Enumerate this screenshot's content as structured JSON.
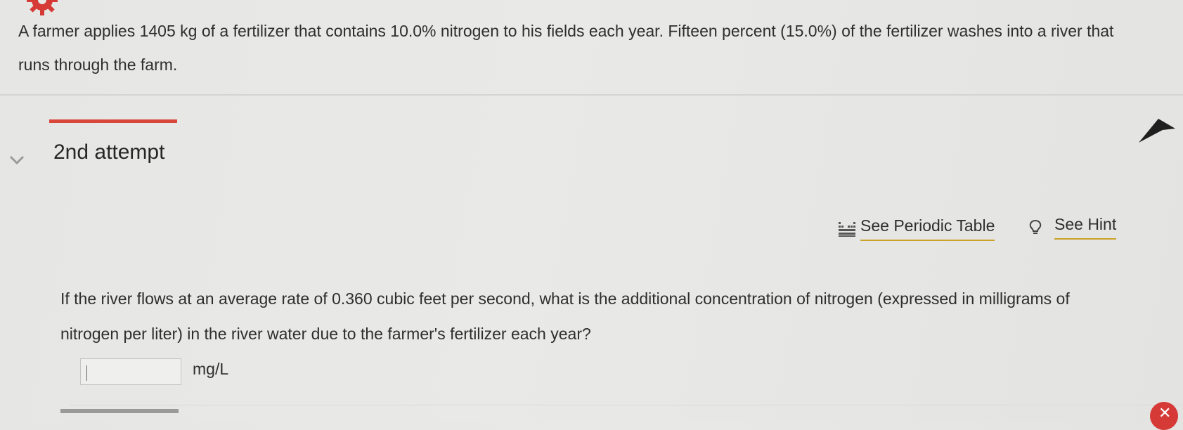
{
  "problem": {
    "text": "A farmer applies 1405 kg of a fertilizer that contains 10.0% nitrogen to his fields each year. Fifteen percent (15.0%) of the fertilizer washes into a river that runs through the farm."
  },
  "attempt": {
    "title": "2nd attempt"
  },
  "tools": {
    "periodic_table_label": "See Periodic Table",
    "hint_label": "See Hint"
  },
  "question": {
    "text": "If the river flows at an average rate of 0.360 cubic feet per second, what is the additional concentration of nitrogen (expressed in milligrams of nitrogen per liter) in the river water due to the farmer's fertilizer each year?"
  },
  "answer": {
    "value": "",
    "unit": "mg/L"
  },
  "icons": {
    "top": "gear-icon",
    "collapse": "chevron-down-icon",
    "periodic": "periodic-table-icon",
    "hint": "lightbulb-icon",
    "pointer": "mouse-cursor-icon",
    "close": "close-icon"
  },
  "colors": {
    "accent_red": "#d9473a",
    "link_underline": "#c9a227",
    "gear_red": "#d63a36"
  }
}
